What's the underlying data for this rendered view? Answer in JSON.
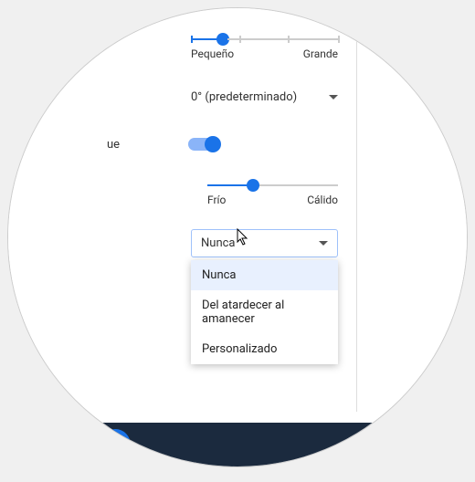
{
  "sizeSlider": {
    "leftLabel": "Pequeño",
    "rightLabel": "Grande",
    "percent": 22
  },
  "orientation": {
    "value": "0° (predeterminado)"
  },
  "nightLightLabel": "ue",
  "toggleOn": true,
  "warmSlider": {
    "leftLabel": "Frío",
    "rightLabel": "Cálido",
    "percent": 35
  },
  "schedule": {
    "selected": "Nunca",
    "options": [
      "Nunca",
      "Del atardecer al amanecer",
      "Personalizado"
    ]
  }
}
